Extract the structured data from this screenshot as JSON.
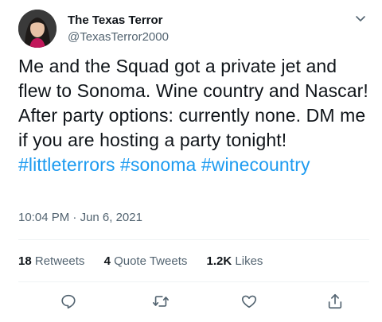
{
  "user": {
    "display_name": "The Texas Terror",
    "handle": "@TexasTerror2000"
  },
  "tweet": {
    "text": "Me and the Squad got a private jet and flew to Sonoma. Wine country and Nascar! After party options: currently none. DM me if you are hosting a party tonight! ",
    "hashtags": [
      "#littleterrors",
      "#sonoma",
      "#winecountry"
    ]
  },
  "meta": {
    "time": "10:04 PM",
    "separator": "·",
    "date": "Jun 6, 2021"
  },
  "stats": {
    "retweets_count": "18",
    "retweets_label": "Retweets",
    "quotes_count": "4",
    "quotes_label": "Quote Tweets",
    "likes_count": "1.2K",
    "likes_label": "Likes"
  },
  "colors": {
    "link": "#1d9bf0",
    "secondary_text": "#536471",
    "primary_text": "#0f1419",
    "divider": "#eff3f4"
  },
  "icons": [
    "chevron-down-icon",
    "reply-icon",
    "retweet-icon",
    "like-icon",
    "share-icon"
  ]
}
